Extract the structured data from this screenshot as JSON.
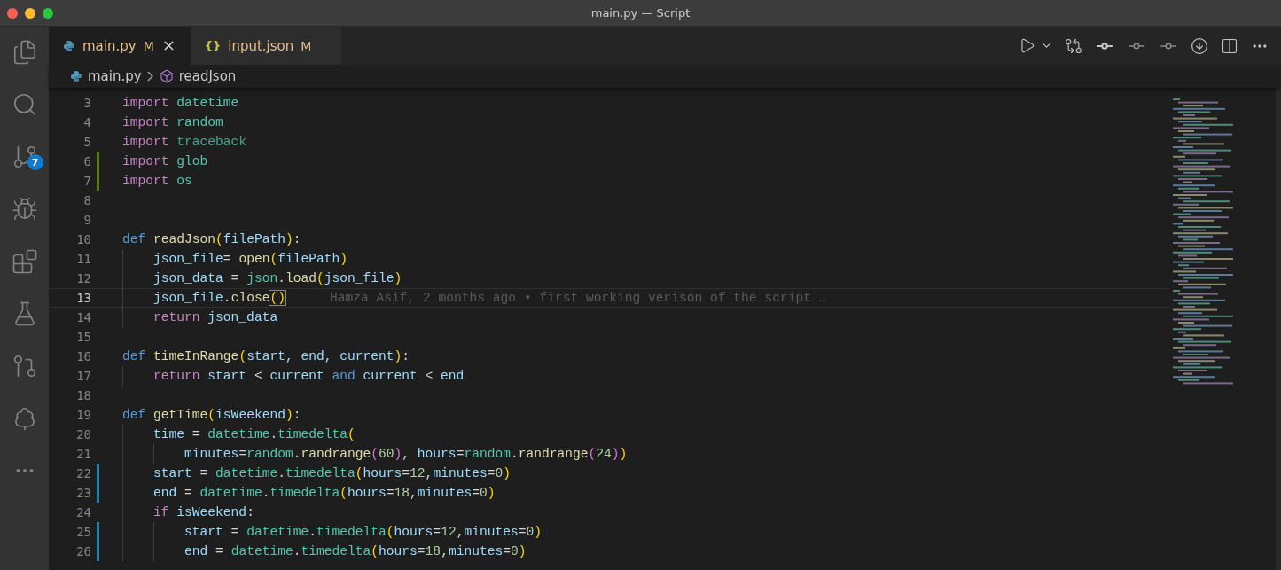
{
  "window": {
    "title": "main.py — Script"
  },
  "activity_bar": {
    "source_control_badge": "7"
  },
  "tabs": [
    {
      "label": "main.py",
      "status": "M",
      "selected": true,
      "kind": "python"
    },
    {
      "label": "input.json",
      "status": "M",
      "selected": false,
      "kind": "json",
      "glyph": "{}"
    }
  ],
  "breadcrumb": {
    "file": "main.py",
    "symbol": "readJson"
  },
  "code_lines": [
    {
      "number": "3",
      "current": false,
      "kind": "plain",
      "tokens": [
        {
          "t": "import",
          "color": "#c586c0"
        },
        {
          "t": " datetime",
          "color": "#4ec9b0"
        }
      ]
    },
    {
      "number": "4",
      "current": false,
      "kind": "plain",
      "tokens": [
        {
          "t": "import",
          "color": "#c586c0"
        },
        {
          "t": " random",
          "color": "#4ec9b0"
        }
      ]
    },
    {
      "number": "5",
      "current": false,
      "kind": "plain",
      "tokens": [
        {
          "t": "import",
          "color": "#c586c0"
        },
        {
          "t": " traceback",
          "color": "#3fa88f"
        }
      ]
    },
    {
      "number": "6",
      "current": false,
      "kind": "added",
      "tokens": [
        {
          "t": "import",
          "color": "#c586c0"
        },
        {
          "t": " glob",
          "color": "#4ec9b0"
        }
      ]
    },
    {
      "number": "7",
      "current": false,
      "kind": "added",
      "tokens": [
        {
          "t": "import",
          "color": "#c586c0"
        },
        {
          "t": " os",
          "color": "#4ec9b0"
        }
      ]
    },
    {
      "number": "8",
      "current": false,
      "kind": "plain"
    },
    {
      "number": "9",
      "current": false,
      "kind": "plain"
    },
    {
      "number": "10",
      "current": false,
      "kind": "plain",
      "tokens": [
        {
          "t": "def",
          "color": "#569cd6"
        },
        {
          "t": " readJson",
          "color": "#dcdcaa"
        },
        {
          "t": "(",
          "color": "#ffd700"
        },
        {
          "t": "filePath",
          "color": "#9cdcfe"
        },
        {
          "t": ")",
          "color": "#ffd700"
        },
        {
          "t": ":"
        }
      ]
    },
    {
      "number": "11",
      "current": false,
      "kind": "plain",
      "tokens": [
        {
          "t": "    json_file",
          "color": "#9cdcfe"
        },
        {
          "t": "= "
        },
        {
          "t": "open",
          "color": "#dcdcaa"
        },
        {
          "t": "(",
          "color": "#ffd700"
        },
        {
          "t": "filePath",
          "color": "#9cdcfe"
        },
        {
          "t": ")",
          "color": "#ffd700"
        }
      ]
    },
    {
      "number": "12",
      "current": false,
      "kind": "plain",
      "tokens": [
        {
          "t": "    json_data",
          "color": "#9cdcfe"
        },
        {
          "t": " = "
        },
        {
          "t": "json",
          "color": "#4ec9b0"
        },
        {
          "t": "."
        },
        {
          "t": "load",
          "color": "#dcdcaa"
        },
        {
          "t": "(",
          "color": "#ffd700"
        },
        {
          "t": "json_file",
          "color": "#9cdcfe"
        },
        {
          "t": ")",
          "color": "#ffd700"
        }
      ]
    },
    {
      "number": "13",
      "current": true,
      "kind": "plain",
      "tokens": [
        {
          "t": "    json_file",
          "color": "#9cdcfe"
        },
        {
          "t": "."
        },
        {
          "t": "close",
          "color": "#dcdcaa"
        },
        {
          "t": "()",
          "color": "#ffd700"
        }
      ],
      "blame": "Hamza Asif, 2 months ago • first working verison of the script …"
    },
    {
      "number": "14",
      "current": false,
      "kind": "plain",
      "tokens": [
        {
          "t": "    return",
          "color": "#c586c0"
        },
        {
          "t": " json_data",
          "color": "#9cdcfe"
        }
      ]
    },
    {
      "number": "15",
      "current": false,
      "kind": "plain"
    },
    {
      "number": "16",
      "current": false,
      "kind": "plain",
      "tokens": [
        {
          "t": "def",
          "color": "#569cd6"
        },
        {
          "t": " timeInRange",
          "color": "#dcdcaa"
        },
        {
          "t": "(",
          "color": "#ffd700"
        },
        {
          "t": "start, end, current",
          "color": "#9cdcfe"
        },
        {
          "t": ")",
          "color": "#ffd700"
        },
        {
          "t": ":"
        }
      ]
    },
    {
      "number": "17",
      "current": false,
      "kind": "plain",
      "tokens": [
        {
          "t": "    return",
          "color": "#c586c0"
        },
        {
          "t": " start",
          "color": "#9cdcfe"
        },
        {
          "t": " < "
        },
        {
          "t": "current",
          "color": "#9cdcfe"
        },
        {
          "t": " and ",
          "color": "#569cd6"
        },
        {
          "t": "current",
          "color": "#9cdcfe"
        },
        {
          "t": " < "
        },
        {
          "t": "end",
          "color": "#9cdcfe"
        }
      ]
    },
    {
      "number": "18",
      "current": false,
      "kind": "plain"
    },
    {
      "number": "19",
      "current": false,
      "kind": "plain",
      "tokens": [
        {
          "t": "def",
          "color": "#569cd6"
        },
        {
          "t": " getTime",
          "color": "#dcdcaa"
        },
        {
          "t": "(",
          "color": "#ffd700"
        },
        {
          "t": "isWeekend",
          "color": "#9cdcfe"
        },
        {
          "t": ")",
          "color": "#ffd700"
        },
        {
          "t": ":"
        }
      ]
    },
    {
      "number": "20",
      "current": false,
      "kind": "plain",
      "tokens": [
        {
          "t": "    time",
          "color": "#9cdcfe"
        },
        {
          "t": " = "
        },
        {
          "t": "datetime",
          "color": "#4ec9b0"
        },
        {
          "t": "."
        },
        {
          "t": "timedelta",
          "color": "#4ec9b0"
        },
        {
          "t": "(",
          "color": "#ffd700"
        }
      ]
    },
    {
      "number": "21",
      "current": false,
      "kind": "plain",
      "tokens": [
        {
          "t": "        minutes",
          "color": "#9cdcfe"
        },
        {
          "t": "="
        },
        {
          "t": "random",
          "color": "#4ec9b0"
        },
        {
          "t": "."
        },
        {
          "t": "randrange",
          "color": "#dcdcaa"
        },
        {
          "t": "(",
          "color": "#da70d6"
        },
        {
          "t": "60",
          "color": "#b5cea8"
        },
        {
          "t": ")",
          "color": "#da70d6"
        },
        {
          "t": ", "
        },
        {
          "t": "hours",
          "color": "#9cdcfe"
        },
        {
          "t": "="
        },
        {
          "t": "random",
          "color": "#4ec9b0"
        },
        {
          "t": "."
        },
        {
          "t": "randrange",
          "color": "#dcdcaa"
        },
        {
          "t": "(",
          "color": "#da70d6"
        },
        {
          "t": "24",
          "color": "#b5cea8"
        },
        {
          "t": ")",
          "color": "#da70d6"
        },
        {
          "t": ")",
          "color": "#ffd700"
        }
      ]
    },
    {
      "number": "22",
      "current": false,
      "kind": "modified",
      "tokens": [
        {
          "t": "    start",
          "color": "#9cdcfe"
        },
        {
          "t": " = "
        },
        {
          "t": "datetime",
          "color": "#4ec9b0"
        },
        {
          "t": "."
        },
        {
          "t": "timedelta",
          "color": "#4ec9b0"
        },
        {
          "t": "(",
          "color": "#ffd700"
        },
        {
          "t": "hours",
          "color": "#9cdcfe"
        },
        {
          "t": "="
        },
        {
          "t": "12",
          "color": "#b5cea8"
        },
        {
          "t": ","
        },
        {
          "t": "minutes",
          "color": "#9cdcfe"
        },
        {
          "t": "="
        },
        {
          "t": "0",
          "color": "#b5cea8"
        },
        {
          "t": ")",
          "color": "#ffd700"
        }
      ]
    },
    {
      "number": "23",
      "current": false,
      "kind": "modified",
      "tokens": [
        {
          "t": "    end",
          "color": "#9cdcfe"
        },
        {
          "t": " = "
        },
        {
          "t": "datetime",
          "color": "#4ec9b0"
        },
        {
          "t": "."
        },
        {
          "t": "timedelta",
          "color": "#4ec9b0"
        },
        {
          "t": "(",
          "color": "#ffd700"
        },
        {
          "t": "hours",
          "color": "#9cdcfe"
        },
        {
          "t": "="
        },
        {
          "t": "18",
          "color": "#b5cea8"
        },
        {
          "t": ","
        },
        {
          "t": "minutes",
          "color": "#9cdcfe"
        },
        {
          "t": "="
        },
        {
          "t": "0",
          "color": "#b5cea8"
        },
        {
          "t": ")",
          "color": "#ffd700"
        }
      ]
    },
    {
      "number": "24",
      "current": false,
      "kind": "plain",
      "tokens": [
        {
          "t": "    if",
          "color": "#c586c0"
        },
        {
          "t": " isWeekend",
          "color": "#9cdcfe"
        },
        {
          "t": ":"
        }
      ]
    },
    {
      "number": "25",
      "current": false,
      "kind": "modified",
      "tokens": [
        {
          "t": "        start",
          "color": "#9cdcfe"
        },
        {
          "t": " = "
        },
        {
          "t": "datetime",
          "color": "#4ec9b0"
        },
        {
          "t": "."
        },
        {
          "t": "timedelta",
          "color": "#4ec9b0"
        },
        {
          "t": "(",
          "color": "#ffd700"
        },
        {
          "t": "hours",
          "color": "#9cdcfe"
        },
        {
          "t": "="
        },
        {
          "t": "12",
          "color": "#b5cea8"
        },
        {
          "t": ","
        },
        {
          "t": "minutes",
          "color": "#9cdcfe"
        },
        {
          "t": "="
        },
        {
          "t": "0",
          "color": "#b5cea8"
        },
        {
          "t": ")",
          "color": "#ffd700"
        }
      ]
    },
    {
      "number": "26",
      "current": false,
      "kind": "modified",
      "tokens": [
        {
          "t": "        end",
          "color": "#9cdcfe"
        },
        {
          "t": " = "
        },
        {
          "t": "datetime",
          "color": "#4ec9b0"
        },
        {
          "t": "."
        },
        {
          "t": "timedelta",
          "color": "#4ec9b0"
        },
        {
          "t": "(",
          "color": "#ffd700"
        },
        {
          "t": "hours",
          "color": "#9cdcfe"
        },
        {
          "t": "="
        },
        {
          "t": "18",
          "color": "#b5cea8"
        },
        {
          "t": ","
        },
        {
          "t": "minutes",
          "color": "#9cdcfe"
        },
        {
          "t": "="
        },
        {
          "t": "0",
          "color": "#b5cea8"
        },
        {
          "t": ")",
          "color": "#ffd700"
        }
      ]
    }
  ]
}
